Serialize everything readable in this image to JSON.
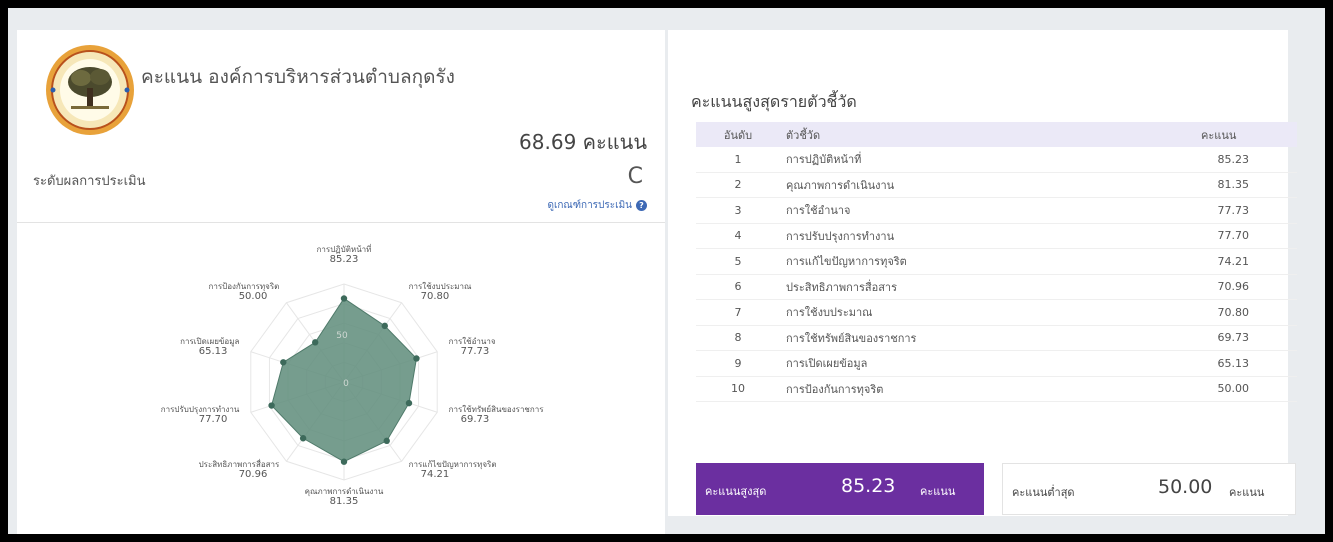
{
  "left": {
    "org_title": "คะแนน องค์การบริหารส่วนตำบลกุดรัง",
    "score_text": "68.69 คะแนน",
    "level_label": "ระดับผลการประเมิน",
    "grade": "C",
    "criteria_link": "ดูเกณฑ์การประเมิน"
  },
  "right": {
    "title": "คะแนนสูงสุดรายตัวชี้วัด",
    "columns": [
      "อันดับ",
      "ตัวชี้วัด",
      "คะแนน"
    ],
    "rows": [
      {
        "rank": "1",
        "name": "การปฏิบัติหน้าที่",
        "score": "85.23"
      },
      {
        "rank": "2",
        "name": "คุณภาพการดำเนินงาน",
        "score": "81.35"
      },
      {
        "rank": "3",
        "name": "การใช้อำนาจ",
        "score": "77.73"
      },
      {
        "rank": "4",
        "name": "การปรับปรุงการทำงาน",
        "score": "77.70"
      },
      {
        "rank": "5",
        "name": "การแก้ไขปัญหาการทุจริต",
        "score": "74.21"
      },
      {
        "rank": "6",
        "name": "ประสิทธิภาพการสื่อสาร",
        "score": "70.96"
      },
      {
        "rank": "7",
        "name": "การใช้งบประมาณ",
        "score": "70.80"
      },
      {
        "rank": "8",
        "name": "การใช้ทรัพย์สินของราชการ",
        "score": "69.73"
      },
      {
        "rank": "9",
        "name": "การเปิดเผยข้อมูล",
        "score": "65.13"
      },
      {
        "rank": "10",
        "name": "การป้องกันการทุจริต",
        "score": "50.00"
      }
    ],
    "max_label": "คะแนนสูงสุด",
    "max_value": "85.23",
    "min_label": "คะแนนต่ำสุด",
    "min_value": "50.00",
    "unit": "คะแนน"
  },
  "colors": {
    "accent_purple": "#6b2fa0",
    "radar_fill": "#5e8c7a",
    "radar_point": "#3d6a5b",
    "link": "#3d69b5"
  },
  "chart_data": {
    "type": "radar",
    "categories": [
      "การปฏิบัติหน้าที่",
      "การใช้งบประมาณ",
      "การใช้อำนาจ",
      "การใช้ทรัพย์สินของราชการ",
      "การแก้ไขปัญหาการทุจริต",
      "คุณภาพการดำเนินงาน",
      "ประสิทธิภาพการสื่อสาร",
      "การปรับปรุงการทำงาน",
      "การเปิดเผยข้อมูล",
      "การป้องกันการทุจริต"
    ],
    "values": [
      85.23,
      70.8,
      77.73,
      69.73,
      74.21,
      81.35,
      70.96,
      77.7,
      65.13,
      50.0
    ],
    "value_labels": [
      "85.23",
      "70.80",
      "77.73",
      "69.73",
      "74.21",
      "81.35",
      "70.96",
      "77.70",
      "65.13",
      "50.00"
    ],
    "range": [
      0,
      100
    ],
    "tick_labels": [
      "0",
      "50"
    ],
    "grid": true
  }
}
